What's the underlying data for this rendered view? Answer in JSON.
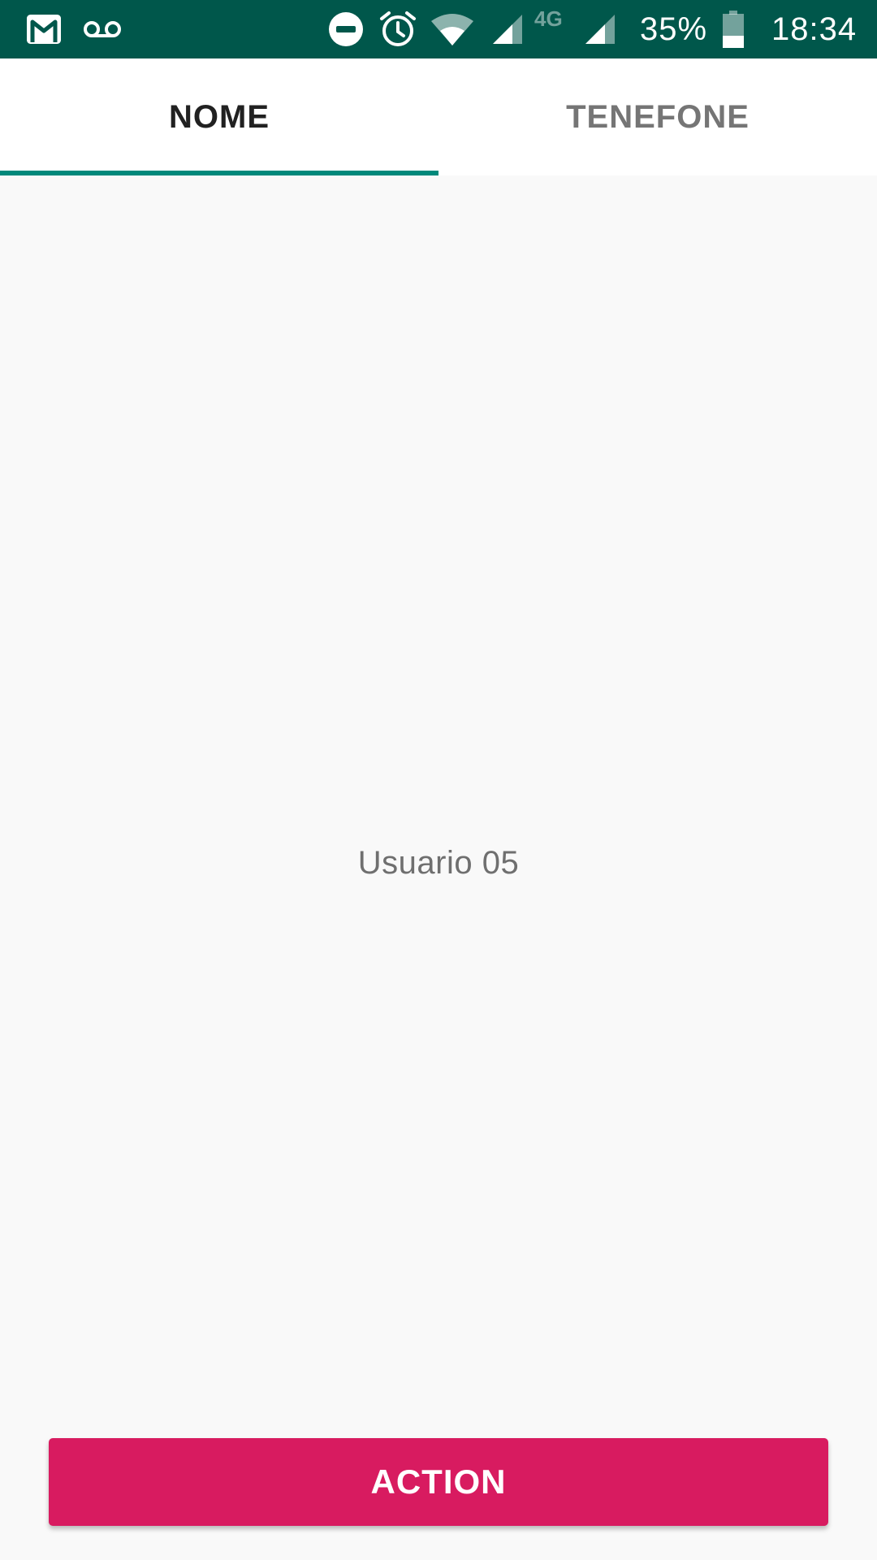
{
  "status_bar": {
    "background": "#00574b",
    "icons_left": [
      "gmail-icon",
      "voicemail-icon"
    ],
    "icons_right": [
      "do-not-disturb-icon",
      "alarm-icon",
      "wifi-icon",
      "signal-icon",
      "signal-4g-icon"
    ],
    "network_label": "4G",
    "battery_percent": "35%",
    "battery_level": 0.35,
    "time": "18:34"
  },
  "tabs": [
    {
      "label": "NOME",
      "selected": true
    },
    {
      "label": "TENEFONE",
      "selected": false
    }
  ],
  "accent": "#00897b",
  "content": {
    "text": "Usuario 05"
  },
  "action_button": {
    "label": "ACTION",
    "color": "#d81b60"
  }
}
